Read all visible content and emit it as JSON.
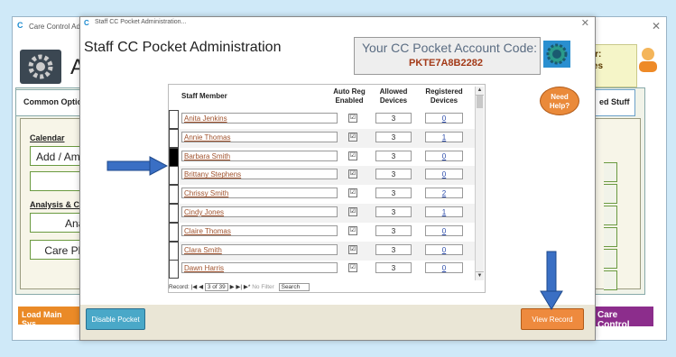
{
  "background": {
    "window_title": "Care Control Adm",
    "heading": "A",
    "user_line1": "ser:",
    "user_line2": "mes",
    "tab_left": "Common Optio",
    "tab_right": "ed Stuff",
    "calendar_label": "Calendar",
    "add_amend_label": "Add / Ame",
    "analysis_label": "Analysis & Co",
    "anal_label": "Anal",
    "care_plan_label": "Care Pla",
    "load_main_label": "Load Main Sys",
    "care_control_label": "Care Control"
  },
  "dialog": {
    "window_title": "Staff CC Pocket Administration...",
    "heading": "Staff CC Pocket Administration",
    "code_label": "Your CC Pocket Account Code:",
    "code_value": "PKTE7A8B2282",
    "need_help": "Need Help?",
    "disable_button": "Disable Pocket",
    "view_record_button": "View Record"
  },
  "grid": {
    "headers": {
      "staff_member": "Staff Member",
      "auto_reg": "Auto Reg Enabled",
      "allowed": "Allowed Devices",
      "registered": "Registered Devices"
    },
    "rows": [
      {
        "name": "Anita Jenkins",
        "auto_reg": "☑",
        "allowed": "3",
        "registered": "0"
      },
      {
        "name": "Annie Thomas",
        "auto_reg": "☑",
        "allowed": "3",
        "registered": "1"
      },
      {
        "name": "Barbara Smith",
        "auto_reg": "☑",
        "allowed": "3",
        "registered": "0"
      },
      {
        "name": "Brittany Stephens",
        "auto_reg": "☑",
        "allowed": "3",
        "registered": "0"
      },
      {
        "name": "Chrissy Smith",
        "auto_reg": "☑",
        "allowed": "3",
        "registered": "2"
      },
      {
        "name": "Cindy Jones",
        "auto_reg": "☑",
        "allowed": "3",
        "registered": "1"
      },
      {
        "name": "Claire Thomas",
        "auto_reg": "☑",
        "allowed": "3",
        "registered": "0"
      },
      {
        "name": "Clara Smith",
        "auto_reg": "☑",
        "allowed": "3",
        "registered": "0"
      },
      {
        "name": "Dawn Harris",
        "auto_reg": "☑",
        "allowed": "3",
        "registered": "0"
      }
    ],
    "selected_row": 2,
    "nav": {
      "record_label": "Record:",
      "position": "3 of 39",
      "no_filter": "No Filter",
      "search": "Search"
    }
  },
  "colors": {
    "accent_orange": "#ee8a3e",
    "teal_button": "#4aa8c8",
    "arrow_blue": "#3a6fc4",
    "code_text": "#a33a18"
  }
}
